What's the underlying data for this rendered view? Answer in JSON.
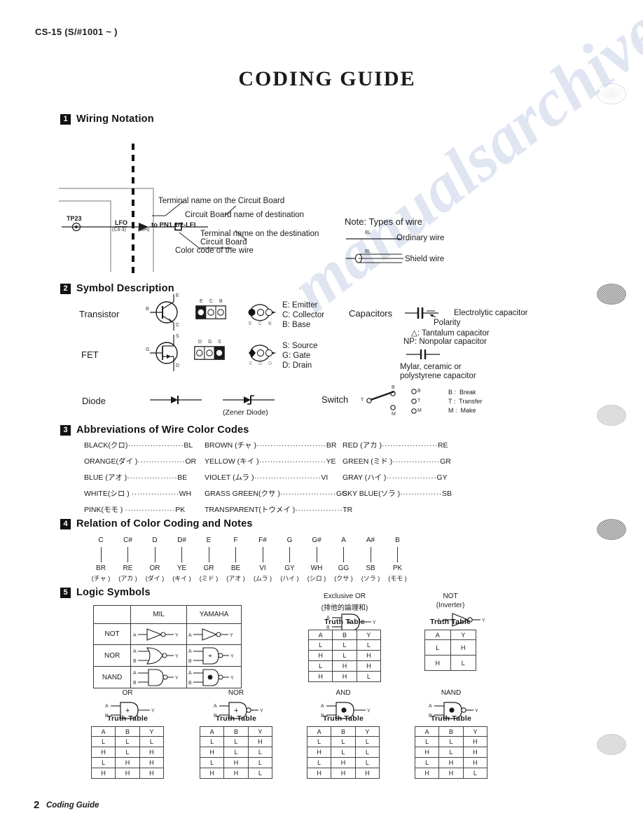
{
  "header": {
    "model_id": "CS-15 (S/#1001 ~ )",
    "title": "CODING  GUIDE"
  },
  "sections": {
    "s1": {
      "num": "1",
      "title": "Wiring Notation"
    },
    "s2": {
      "num": "2",
      "title": "Symbol Description"
    },
    "s3": {
      "num": "3",
      "title": "Abbreviations of Wire Color Codes"
    },
    "s4": {
      "num": "4",
      "title": "Relation of Color Coding and Notes"
    },
    "s5": {
      "num": "5",
      "title": "Logic Symbols"
    }
  },
  "wiring": {
    "test_point": "TP23",
    "terminal": "LFO",
    "terminal_sub": "(C4-3)",
    "wire_color": "(WH)",
    "destination": "to PN1.1/2-LFI",
    "callouts": {
      "terminal_name": "Terminal name on the Circuit Board",
      "board_name": "Circuit Board name of destination",
      "dest_terminal_1": "Terminal name on the destination",
      "dest_terminal_2": "Circuit Board",
      "color_code": "Color code of the wire"
    },
    "note": {
      "title": "Note: Types of wire",
      "ordinary_label": "Ordinary wire",
      "ordinary_code": "BL",
      "shield_label": "Shield wire",
      "shield_code": "BL"
    }
  },
  "symbols": {
    "transistor": {
      "name": "Transistor",
      "schematic_pins": {
        "b": "B",
        "e": "E",
        "c": "C"
      },
      "package_top": [
        "E",
        "C",
        "B"
      ],
      "package_bottom": [
        "E",
        "C",
        "B"
      ],
      "legend": [
        "E: Emitter",
        "C: Collector",
        "B: Base"
      ]
    },
    "fet": {
      "name": "FET",
      "schematic_pins": {
        "g": "G",
        "s": "S",
        "d": "D"
      },
      "package_top": [
        "D",
        "G",
        "S"
      ],
      "package_bottom": [
        "S",
        "G",
        "D"
      ],
      "legend": [
        "S: Source",
        "G: Gate",
        "D: Drain"
      ]
    },
    "diode": {
      "name": "Diode",
      "zener_caption": "(Zener Diode)"
    },
    "capacitors": {
      "name": "Capacitors",
      "electrolytic": "Electrolytic capacitor",
      "polarity": "Polarity",
      "tantalum": "△: Tantalum capacitor",
      "nonpolar": "NP: Nonpolar capacitor",
      "mylar_1": "Mylar, ceramic or",
      "mylar_2": "polystyrene capacitor"
    },
    "switch": {
      "name": "Switch",
      "terminals": [
        "B",
        "T",
        "M"
      ],
      "key_terminals": [
        "B",
        "T",
        "M"
      ],
      "legend": [
        "B :  Break",
        "T :  Transfer",
        "M :  Make"
      ]
    }
  },
  "color_codes": {
    "col1": [
      {
        "name": "BLACK(クロ)",
        "code": "BL"
      },
      {
        "name": "ORANGE(ダイ )",
        "code": "OR"
      },
      {
        "name": "BLUE (アオ )",
        "code": "BE"
      },
      {
        "name": "WHITE(シロ ) ",
        "code": "WH"
      },
      {
        "name": "PINK(モモ ) ",
        "code": "PK"
      }
    ],
    "col2": [
      {
        "name": "BROWN (チャ )",
        "code": "BR"
      },
      {
        "name": "YELLOW (キイ )",
        "code": "YE"
      },
      {
        "name": "VIOLET (ムラ )",
        "code": "VI"
      },
      {
        "name": "GRASS GREEN(クサ )",
        "code": "GG"
      },
      {
        "name": "TRANSPARENT(トウメイ )",
        "code": "TR"
      }
    ],
    "col3": [
      {
        "name": "RED (アカ )",
        "code": "RE"
      },
      {
        "name": "GREEN (ミド )",
        "code": "GR"
      },
      {
        "name": "GRAY (ハイ )",
        "code": "GY"
      },
      {
        "name": "SKY BLUE(ソラ )",
        "code": "SB"
      }
    ]
  },
  "note_relation": [
    {
      "note": "C",
      "code": "BR",
      "jp": "(チャ )"
    },
    {
      "note": "C#",
      "code": "RE",
      "jp": "(アカ )"
    },
    {
      "note": "D",
      "code": "OR",
      "jp": "(ダイ )"
    },
    {
      "note": "D#",
      "code": "YE",
      "jp": "(キイ )"
    },
    {
      "note": "E",
      "code": "GR",
      "jp": "(ミド )"
    },
    {
      "note": "F",
      "code": "BE",
      "jp": "(アオ )"
    },
    {
      "note": "F#",
      "code": "VI",
      "jp": "(ムラ )"
    },
    {
      "note": "G",
      "code": "GY",
      "jp": "(ハイ )"
    },
    {
      "note": "G#",
      "code": "WH",
      "jp": "(シロ )"
    },
    {
      "note": "A",
      "code": "GG",
      "jp": "(クサ )"
    },
    {
      "note": "A#",
      "code": "SB",
      "jp": "(ソラ )"
    },
    {
      "note": "B",
      "code": "PK",
      "jp": "(モモ )"
    }
  ],
  "logic": {
    "symbol_table": {
      "headers": [
        "",
        "MIL",
        "YAMAHA"
      ],
      "rows": [
        "NOT",
        "NOR",
        "NAND"
      ],
      "pin_a": "A",
      "pin_b": "B",
      "pin_y": "Y"
    },
    "truth_table_caption": "Truth Table",
    "gates": [
      {
        "name": "Exclusive OR",
        "subtitle": "(排他的論理和)",
        "headers": [
          "A",
          "B",
          "Y"
        ],
        "rows": [
          [
            "L",
            "L",
            "L"
          ],
          [
            "H",
            "L",
            "H"
          ],
          [
            "L",
            "H",
            "H"
          ],
          [
            "H",
            "H",
            "L"
          ]
        ]
      },
      {
        "name": "NOT",
        "subtitle": "(Inverter)",
        "headers": [
          "A",
          "Y"
        ],
        "rows": [
          [
            "L",
            "H"
          ],
          [
            "H",
            "L"
          ]
        ]
      },
      {
        "name": "OR",
        "subtitle": "",
        "headers": [
          "A",
          "B",
          "Y"
        ],
        "rows": [
          [
            "L",
            "L",
            "L"
          ],
          [
            "H",
            "L",
            "H"
          ],
          [
            "L",
            "H",
            "H"
          ],
          [
            "H",
            "H",
            "H"
          ]
        ]
      },
      {
        "name": "NOR",
        "subtitle": "",
        "headers": [
          "A",
          "B",
          "Y"
        ],
        "rows": [
          [
            "L",
            "L",
            "H"
          ],
          [
            "H",
            "L",
            "L"
          ],
          [
            "L",
            "H",
            "L"
          ],
          [
            "H",
            "H",
            "L"
          ]
        ]
      },
      {
        "name": "AND",
        "subtitle": "",
        "headers": [
          "A",
          "B",
          "Y"
        ],
        "rows": [
          [
            "L",
            "L",
            "L"
          ],
          [
            "H",
            "L",
            "L"
          ],
          [
            "L",
            "H",
            "L"
          ],
          [
            "H",
            "H",
            "H"
          ]
        ]
      },
      {
        "name": "NAND",
        "subtitle": "",
        "headers": [
          "A",
          "B",
          "Y"
        ],
        "rows": [
          [
            "L",
            "L",
            "H"
          ],
          [
            "H",
            "L",
            "H"
          ],
          [
            "L",
            "H",
            "H"
          ],
          [
            "H",
            "H",
            "L"
          ]
        ]
      }
    ]
  },
  "footer": {
    "page_number": "2",
    "label": "Coding Guide"
  },
  "watermark": {
    "text": "manualsarchive.com"
  }
}
